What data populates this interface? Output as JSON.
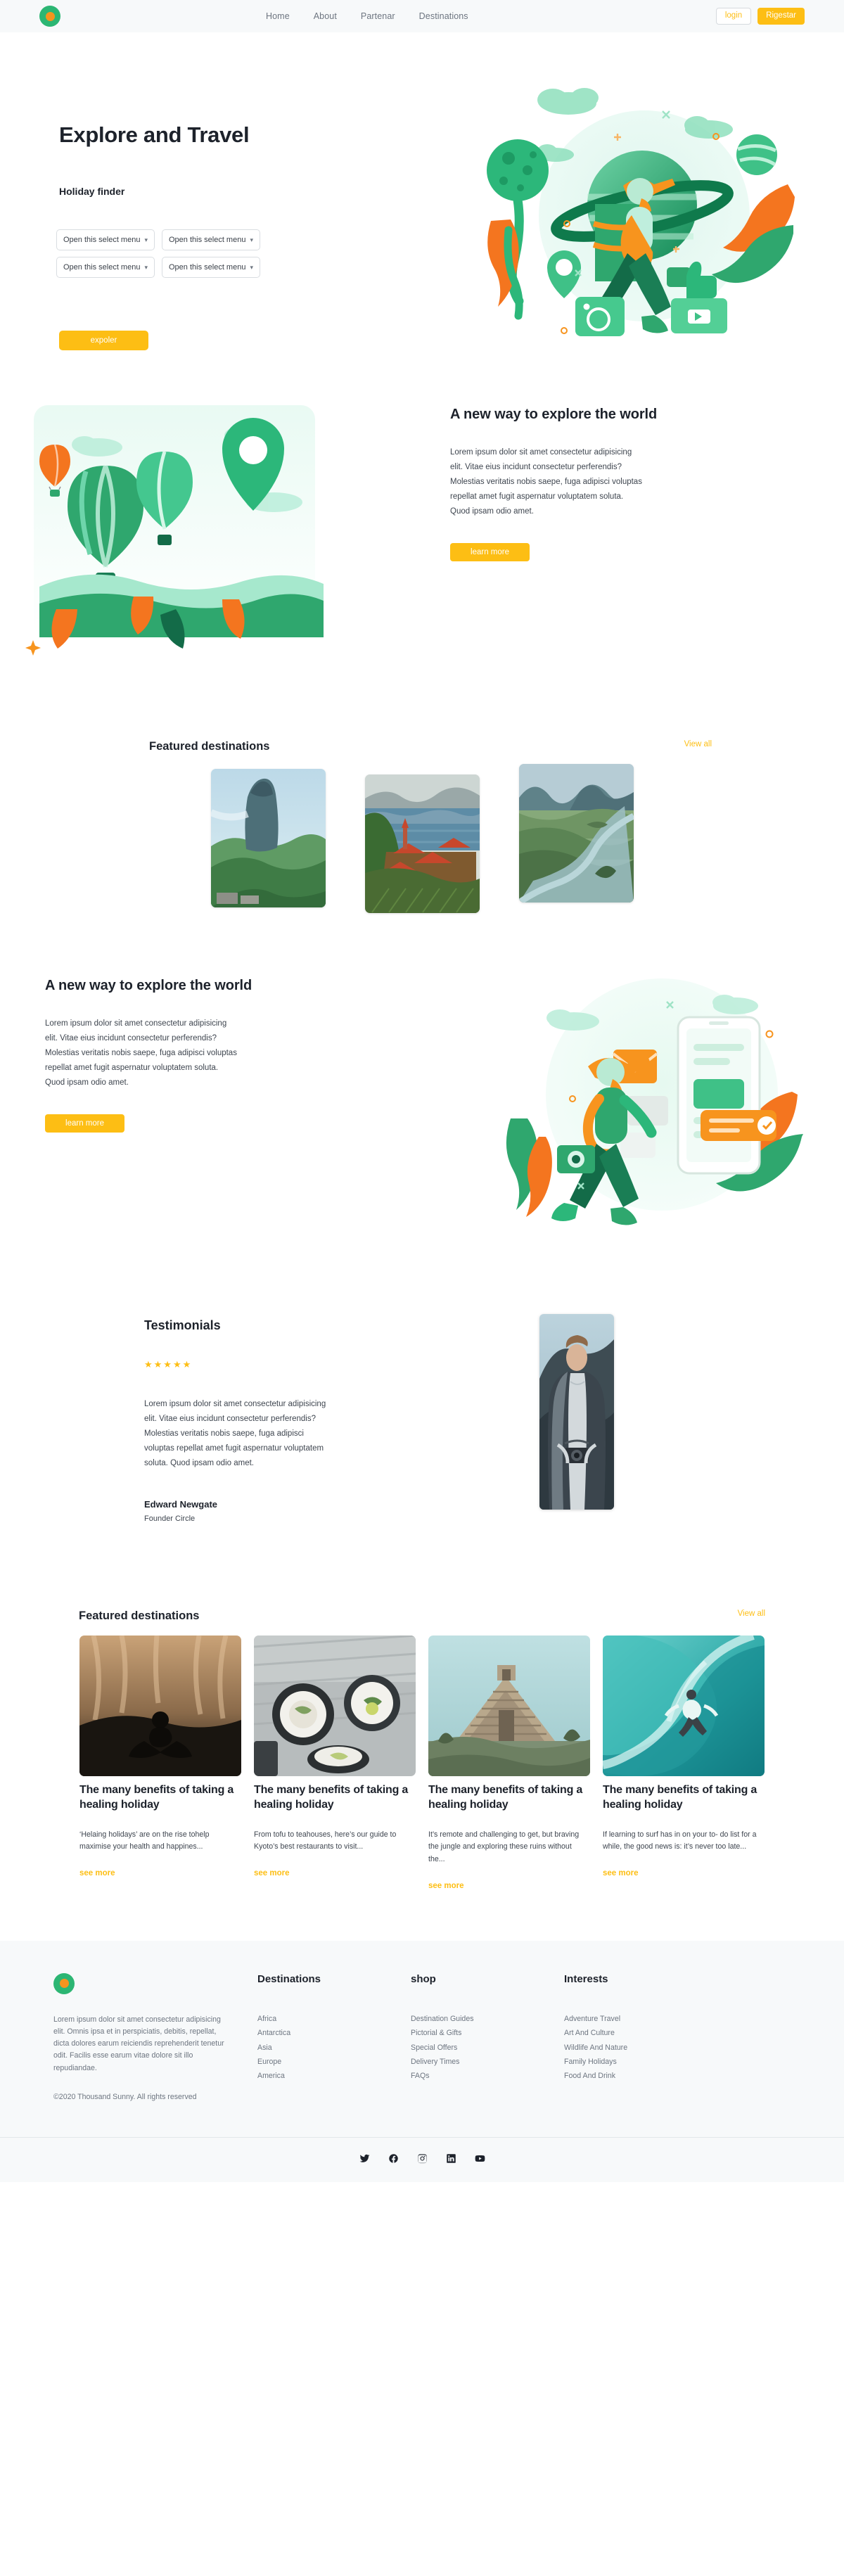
{
  "header": {
    "logo_icon": "circle-target-logo",
    "nav": [
      {
        "label": "Home"
      },
      {
        "label": "About"
      },
      {
        "label": "Partenar"
      },
      {
        "label": "Destinations"
      }
    ],
    "login_label": "login",
    "register_label": "Rigestar"
  },
  "hero": {
    "title": "Explore and Travel",
    "subtitle": "Holiday finder",
    "selects": [
      {
        "value": "Open this select menu"
      },
      {
        "value": "Open this select menu"
      },
      {
        "value": "Open this select menu"
      },
      {
        "value": "Open this select menu"
      }
    ],
    "chevron_icon": "chevron-down-icon",
    "cta_label": "expoler",
    "illustration": "traveler-planet-illustration"
  },
  "section_balloons": {
    "illustration": "hot-air-balloon-map-pin-illustration",
    "title": "A new way to explore the world",
    "body": "Lorem ipsum dolor sit amet consectetur adipisicing elit. Vitae eius incidunt consectetur perferendis? Molestias veritatis nobis saepe, fuga adipisci voluptas repellat amet fugit aspernatur voluptatem soluta. Quod ipsam odio amet.",
    "cta_label": "learn more"
  },
  "featured_destinations": {
    "title": "Featured destinations",
    "view_all_label": "View all",
    "cards": [
      {
        "name": "mountain-pillar-destination"
      },
      {
        "name": "lakeside-village-destination"
      },
      {
        "name": "river-valley-destination"
      }
    ]
  },
  "section_phone": {
    "title": "A new way to explore the world",
    "body": "Lorem ipsum dolor sit amet consectetur adipisicing elit. Vitae eius incidunt consectetur perferendis? Molestias veritatis nobis saepe, fuga adipisci voluptas repellat amet fugit aspernatur voluptatem soluta. Quod ipsam odio amet.",
    "cta_label": "learn more",
    "illustration": "mobile-booking-illustration"
  },
  "testimonials": {
    "title": "Testimonials",
    "rating": 5,
    "stars": "★★★★★",
    "quote": "Lorem ipsum dolor sit amet consectetur adipisicing elit. Vitae eius incidunt consectetur perferendis? Molestias veritatis nobis saepe, fuga adipisci voluptas repellat amet fugit aspernatur voluptatem soluta. Quod ipsam odio amet.",
    "author_name": "Edward Newgate",
    "author_role": "Founder Circle",
    "photo": "photographer-portrait"
  },
  "blog": {
    "title": "Featured destinations",
    "view_all_label": "View all",
    "posts": [
      {
        "image": "yoga-silhouette-photo",
        "title": "The many benefits of taking a healing holiday",
        "excerpt": "‘Helaing holidays’ are on the rise tohelp maximise your health and happines...",
        "link_label": "see more"
      },
      {
        "image": "japanese-food-bowls-photo",
        "title": "The many benefits of taking a healing holiday",
        "excerpt": "From tofu to teahouses, here’s our guide to Kyoto’s best restaurants to visit...",
        "link_label": "see more"
      },
      {
        "image": "mayan-ruins-photo",
        "title": "The many benefits of taking a healing holiday",
        "excerpt": "It’s remote and challenging to get, but braving the jungle and exploring these ruins without the...",
        "link_label": "see more"
      },
      {
        "image": "surfer-wave-photo",
        "title": "The many benefits of taking a healing holiday",
        "excerpt": "If learning to surf has in on your to- do list for a while, the good news is: it’s never too late...",
        "link_label": "see more"
      }
    ]
  },
  "footer": {
    "logo_icon": "circle-target-logo",
    "about": "Lorem ipsum dolor sit amet consectetur adipisicing elit. Omnis ipsa et in perspiciatis, debitis, repellat, dicta dolores earum reiciendis reprehenderit tenetur odit. Facilis esse earum vitae dolore sit illo repudiandae.",
    "copyright": "©2020 Thousand Sunny. All rights reserved",
    "columns": [
      {
        "heading": "Destinations",
        "links": [
          "Africa",
          "Antarctica",
          "Asia",
          "Europe",
          "America"
        ]
      },
      {
        "heading": "shop",
        "links": [
          "Destination Guides",
          "Pictorial & Gifts",
          "Special Offers",
          "Delivery Times",
          "FAQs"
        ]
      },
      {
        "heading": "Interests",
        "links": [
          "Adventure Travel",
          "Art And Culture",
          "Wildlife And Nature",
          "Family Holidays",
          "Food And Drink"
        ]
      }
    ],
    "social": [
      {
        "name": "twitter-icon"
      },
      {
        "name": "facebook-icon"
      },
      {
        "name": "instagram-icon"
      },
      {
        "name": "linkedin-icon"
      },
      {
        "name": "youtube-icon"
      }
    ]
  },
  "colors": {
    "accent_yellow": "#fdbe14",
    "brand_green": "#2cb673",
    "brand_orange": "#f7941e",
    "surface": "#f7f9fa"
  }
}
